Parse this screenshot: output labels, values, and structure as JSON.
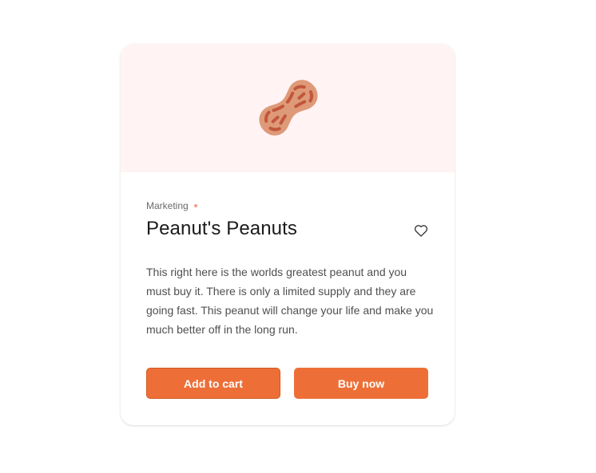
{
  "product": {
    "category": "Marketing",
    "title": "Peanut's Peanuts",
    "description": "This right here is the worlds greatest peanut and you must buy it. There is only a limited supply and they are going fast. This peanut will change your life and make you much better off in the long run.",
    "image_icon": "peanut-icon",
    "favorite_icon": "heart-icon"
  },
  "actions": {
    "add_to_cart_label": "Add to cart",
    "buy_now_label": "Buy now"
  },
  "colors": {
    "accent": "#ed6f37",
    "hero_background": "#fff3f4",
    "category_dot": "#f29a84"
  }
}
